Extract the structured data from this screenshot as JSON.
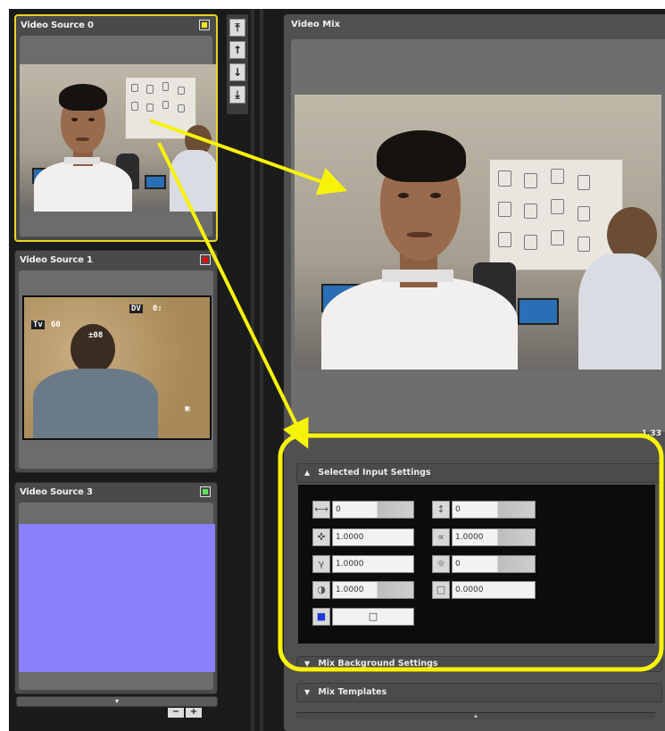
{
  "sources": [
    {
      "title": "Video Source 0",
      "status_color": "#f4e21a",
      "selected": true
    },
    {
      "title": "Video Source 1",
      "status_color": "#e01010",
      "selected": false
    },
    {
      "title": "Video Source 3",
      "status_color": "#5ee15e",
      "selected": false
    }
  ],
  "viewfinder": {
    "mode": "Tv",
    "shutter": "60",
    "exposure": "±08",
    "dv": "DV",
    "counter": "0:",
    "bottom": "▣"
  },
  "list_scroll_glyph": "▾",
  "pm_buttons": {
    "minus": "−",
    "plus": "+"
  },
  "arrow_buttons": [
    "⤒",
    "↑",
    "↓",
    "⤓"
  ],
  "mix": {
    "title": "Video Mix",
    "aspect_ratio": "1.33"
  },
  "settings": {
    "title": "Selected Input Settings",
    "expanded": true,
    "controls": [
      {
        "icon": "horizontal-position-icon",
        "glyph": "⟷",
        "value": "0"
      },
      {
        "icon": "vertical-position-icon",
        "glyph": "↕",
        "value": "0"
      },
      {
        "icon": "scale-icon",
        "glyph": "✜",
        "value": "1.0000"
      },
      {
        "icon": "aspect-icon",
        "glyph": "∝",
        "value": "1.0000"
      },
      {
        "icon": "gamma-icon",
        "glyph": "γ",
        "value": "1.0000"
      },
      {
        "icon": "brightness-icon",
        "glyph": "☼",
        "value": "0"
      },
      {
        "icon": "contrast-icon",
        "glyph": "◑",
        "value": "1.0000"
      },
      {
        "icon": "border-icon",
        "glyph": "□",
        "value": "0.0000"
      },
      {
        "icon": "color-key-icon",
        "glyph": "■",
        "value": "□"
      }
    ]
  },
  "sections": [
    {
      "title": "Mix Background Settings",
      "expanded": false
    },
    {
      "title": "Mix Templates",
      "expanded": false
    }
  ],
  "collapse_glyph": "▴",
  "annotation_color": "#f7f20a"
}
